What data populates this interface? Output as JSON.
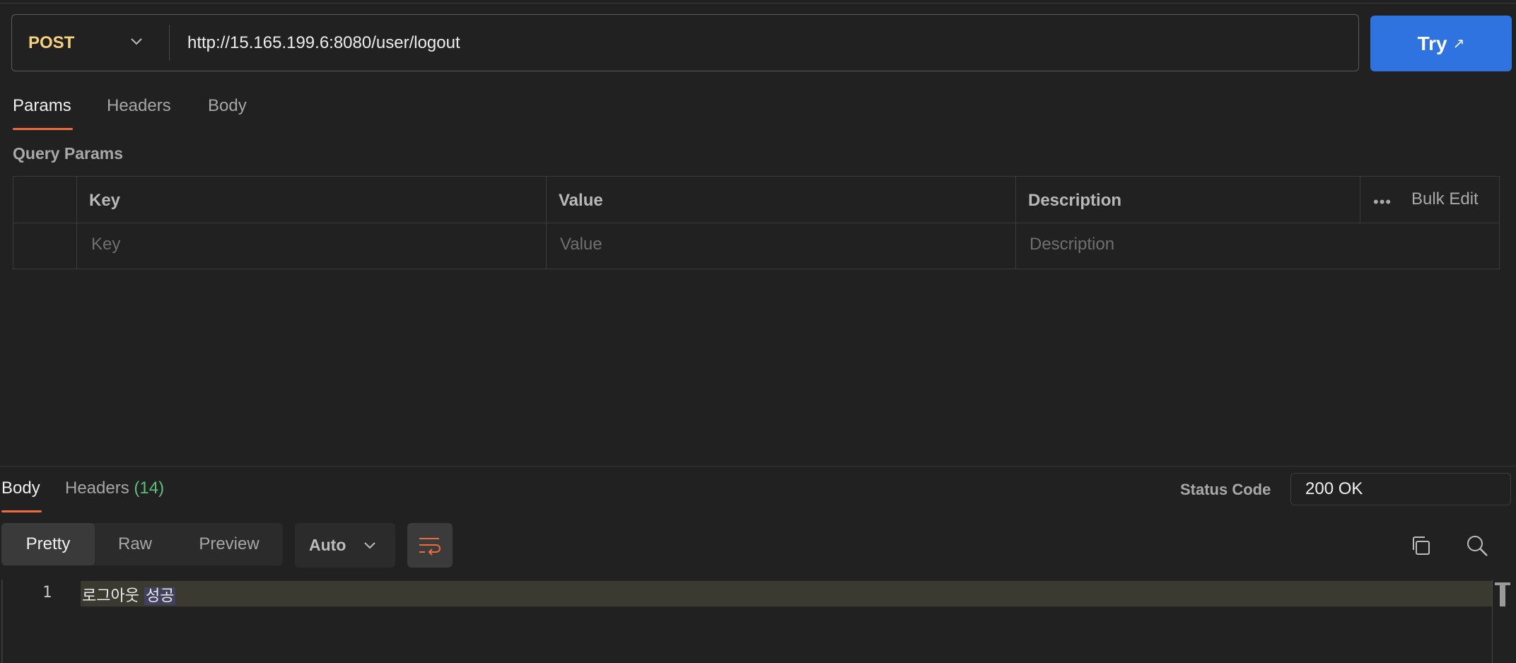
{
  "request": {
    "method": "POST",
    "url": "http://15.165.199.6:8080/user/logout",
    "send_label": "Try",
    "send_icon": "↗"
  },
  "request_tabs": [
    {
      "label": "Params",
      "active": true
    },
    {
      "label": "Headers",
      "active": false
    },
    {
      "label": "Body",
      "active": false
    }
  ],
  "query_params": {
    "title": "Query Params",
    "columns": {
      "key": "Key",
      "value": "Value",
      "description": "Description"
    },
    "bulk_edit": "Bulk Edit",
    "more_icon": "•••",
    "placeholders": {
      "key": "Key",
      "value": "Value",
      "description": "Description"
    }
  },
  "response": {
    "tabs": {
      "body": "Body",
      "headers": "Headers",
      "headers_count": "(14)"
    },
    "status_label": "Status Code",
    "status_value": "200 OK",
    "view_modes": [
      "Pretty",
      "Raw",
      "Preview"
    ],
    "active_view": "Pretty",
    "format": "Auto",
    "lines": [
      {
        "number": "1",
        "text": "로그아웃",
        "selected": "성공"
      }
    ]
  },
  "colors": {
    "accent": "#ee6c3b",
    "primary_button": "#2f73e0",
    "method": "#f5d27a",
    "count": "#5cc07a"
  }
}
